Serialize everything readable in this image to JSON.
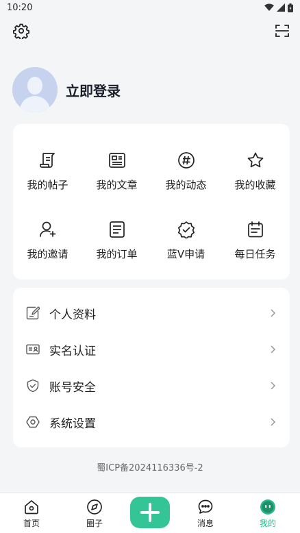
{
  "status": {
    "time": "10:20"
  },
  "profile": {
    "login_label": "立即登录"
  },
  "grid": {
    "row1": [
      {
        "label": "我的帖子",
        "icon": "post-icon"
      },
      {
        "label": "我的文章",
        "icon": "article-icon"
      },
      {
        "label": "我的动态",
        "icon": "hashtag-icon"
      },
      {
        "label": "我的收藏",
        "icon": "star-icon"
      }
    ],
    "row2": [
      {
        "label": "我的邀请",
        "icon": "invite-user-icon"
      },
      {
        "label": "我的订单",
        "icon": "order-icon"
      },
      {
        "label": "蓝V申请",
        "icon": "verified-badge-icon"
      },
      {
        "label": "每日任务",
        "icon": "calendar-icon"
      }
    ]
  },
  "menu": [
    {
      "label": "个人资料",
      "icon": "edit-profile-icon"
    },
    {
      "label": "实名认证",
      "icon": "id-card-icon"
    },
    {
      "label": "账号安全",
      "icon": "shield-icon"
    },
    {
      "label": "系统设置",
      "icon": "settings-hex-icon"
    }
  ],
  "footer": {
    "icp": "蜀ICP备2024116336号-2"
  },
  "tabs": [
    {
      "label": "首页",
      "icon": "home-icon"
    },
    {
      "label": "圈子",
      "icon": "compass-icon"
    },
    {
      "label": "消息",
      "icon": "chat-icon"
    },
    {
      "label": "我的",
      "icon": "profile-face-icon",
      "active": true
    }
  ],
  "colors": {
    "accent": "#34c596",
    "active_tab": "#2bb98a",
    "background": "#f4f5f7"
  }
}
